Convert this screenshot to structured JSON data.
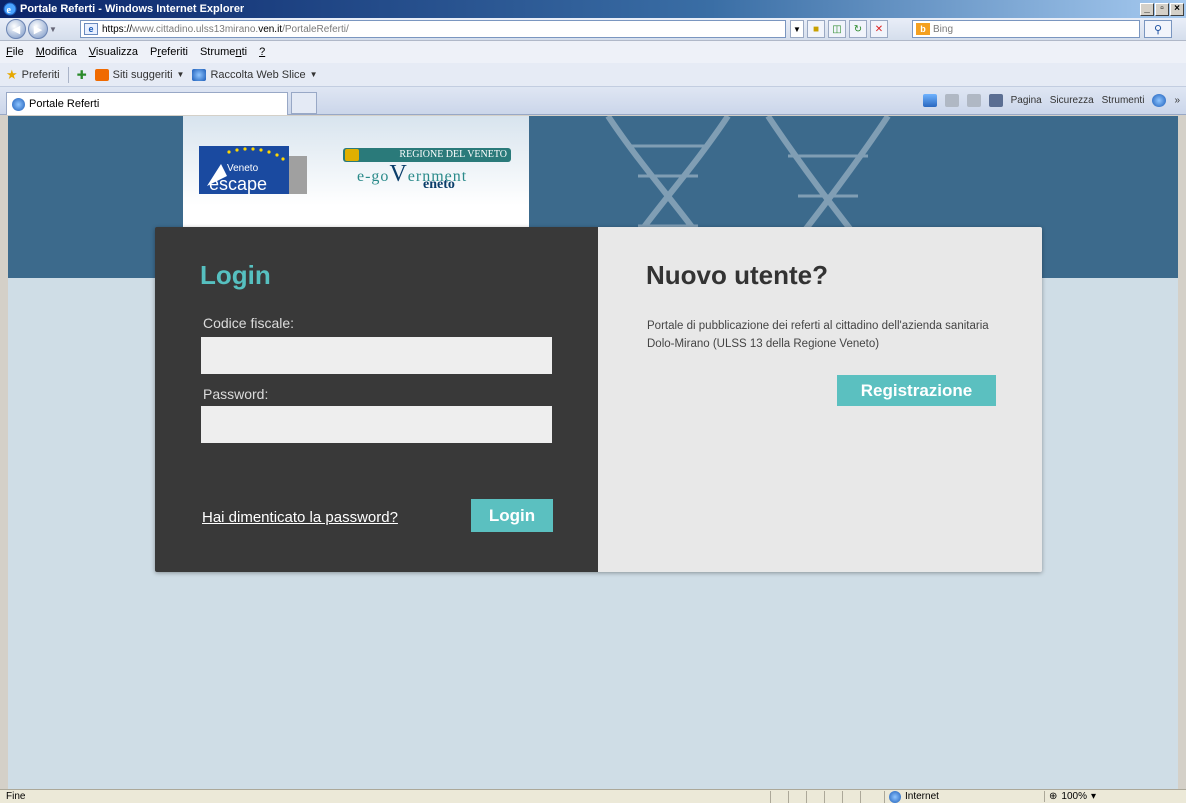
{
  "window": {
    "title": "Portale Referti - Windows Internet Explorer",
    "buttons": [
      "_",
      "▫",
      "×"
    ]
  },
  "address": {
    "prefix": "https://",
    "mid": "www.cittadino.ulss13mirano.",
    "domain": "ven.it",
    "path": "/PortaleReferti/",
    "search_placeholder": "Bing"
  },
  "menu": {
    "items": [
      {
        "pre": "",
        "key": "F",
        "post": "ile"
      },
      {
        "pre": "",
        "key": "M",
        "post": "odifica"
      },
      {
        "pre": "",
        "key": "V",
        "post": "isualizza"
      },
      {
        "pre": "P",
        "key": "r",
        "post": "eferiti"
      },
      {
        "pre": "Strume",
        "key": "n",
        "post": "ti"
      },
      {
        "pre": "",
        "key": "?",
        "post": ""
      }
    ]
  },
  "favorites": {
    "label": "Preferiti",
    "suggested": "Siti suggeriti",
    "webslice": "Raccolta Web Slice"
  },
  "tab": {
    "title": "Portale Referti"
  },
  "commands": {
    "page": "Pagina",
    "security": "Sicurezza",
    "tools": "Strumenti",
    "more": "»"
  },
  "login": {
    "title": "Login",
    "codice_label": "Codice fiscale:",
    "codice_value": "",
    "password_label": "Password:",
    "password_value": "",
    "forgot": "Hai dimenticato la password?",
    "button": "Login"
  },
  "new_user": {
    "title": "Nuovo utente?",
    "description": "Portale di pubblicazione dei referti al cittadino dell'azienda sanitaria Dolo-Mirano (ULSS 13 della Regione Veneto)",
    "button": "Registrazione"
  },
  "logos": {
    "escape_small": "Veneto",
    "escape_big": "escape",
    "gov_banner": "REGIONE DEL VENETO",
    "gov_egov_a": "e-go",
    "gov_egov_b": "V",
    "gov_egov_c": "ernment",
    "gov_veneto": "eneto"
  },
  "status": {
    "text": "Fine",
    "zone": "Internet",
    "zoom": "100%"
  },
  "colors": {
    "accent": "#5bc0c0",
    "hero": "#3c6a8c",
    "page_bg": "#cfdde6",
    "login_panel": "#393939"
  }
}
